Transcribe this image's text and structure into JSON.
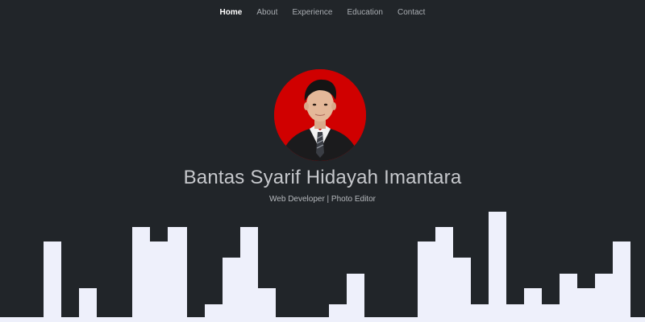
{
  "nav": {
    "items": [
      {
        "label": "Home",
        "active": true
      },
      {
        "label": "About",
        "active": false
      },
      {
        "label": "Experience",
        "active": false
      },
      {
        "label": "Education",
        "active": false
      },
      {
        "label": "Contact",
        "active": false
      }
    ]
  },
  "hero": {
    "name": "Bantas Syarif Hidayah Imantara",
    "tagline": "Web Developer | Photo Editor"
  },
  "colors": {
    "background": "#212529",
    "skyline": "#eef0fb",
    "avatar_bg": "#d00000",
    "nav_active": "#ffffff",
    "nav_inactive": "#a9adb2"
  },
  "icons": {
    "avatar": "profile-photo"
  }
}
